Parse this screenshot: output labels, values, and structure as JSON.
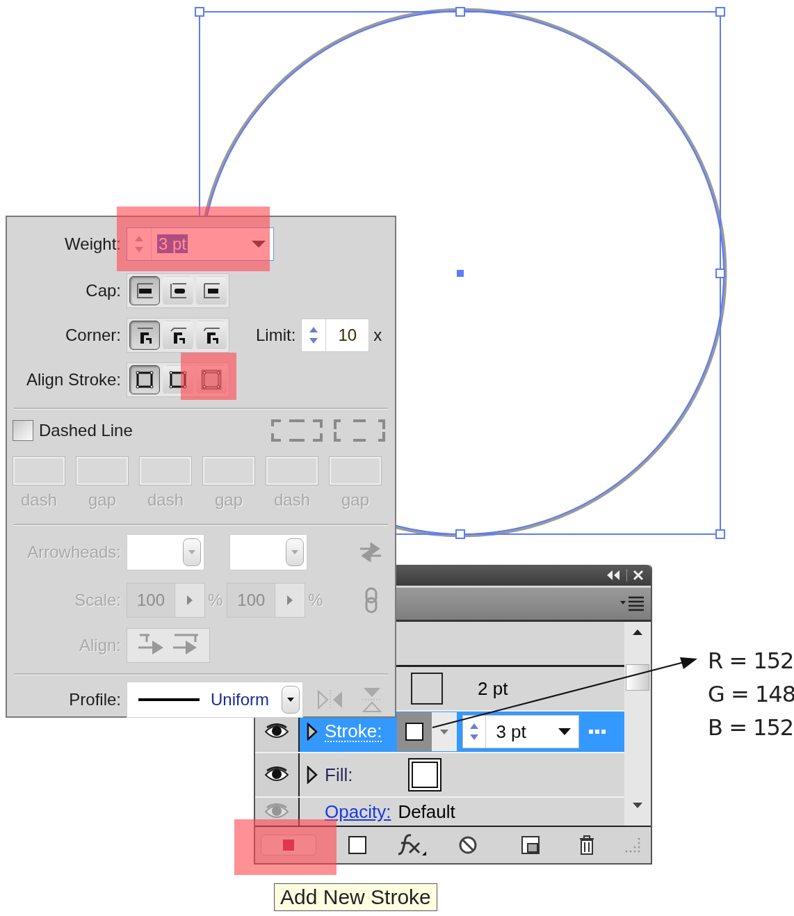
{
  "stroke_panel": {
    "weight": {
      "label": "Weight:",
      "value": "3 pt"
    },
    "cap": {
      "label": "Cap:",
      "options": [
        {
          "selected": true
        },
        {
          "selected": false
        },
        {
          "selected": false
        }
      ]
    },
    "corner": {
      "label": "Corner:",
      "options": [
        {
          "selected": true
        },
        {
          "selected": false
        },
        {
          "selected": false
        }
      ],
      "limit_label": "Limit:",
      "limit_value": "10",
      "limit_unit": "x"
    },
    "align_stroke": {
      "label": "Align Stroke:",
      "options": [
        {
          "selected": true
        },
        {
          "selected": false
        },
        {
          "selected": false
        }
      ]
    },
    "dashed_line": {
      "label": "Dashed Line",
      "checked": false
    },
    "dash_fields": [
      {
        "label": "dash"
      },
      {
        "label": "gap"
      },
      {
        "label": "dash"
      },
      {
        "label": "gap"
      },
      {
        "label": "dash"
      },
      {
        "label": "gap"
      }
    ],
    "arrowheads": {
      "label": "Arrowheads:",
      "disabled": true
    },
    "scale": {
      "label": "Scale:",
      "start": "100",
      "end": "100",
      "start_unit": "%",
      "end_unit": "%",
      "disabled": true
    },
    "align": {
      "label": "Align:",
      "disabled": true
    },
    "profile": {
      "label": "Profile:",
      "value": "Uniform"
    }
  },
  "appearance_panel": {
    "rows": [
      {
        "kind": "stroke_detail",
        "value": "2 pt",
        "selected": false
      },
      {
        "kind": "stroke",
        "label": "Stroke:",
        "value": "3 pt",
        "selected": true
      },
      {
        "kind": "fill",
        "label": "Fill:",
        "selected": false
      },
      {
        "kind": "opacity",
        "label": "Opacity:",
        "value": "Default",
        "selected": false
      }
    ]
  },
  "tooltip": {
    "text": "Add New Stroke"
  },
  "color_note": {
    "lines": [
      "R = 152",
      "G = 148",
      "B = 152"
    ]
  }
}
